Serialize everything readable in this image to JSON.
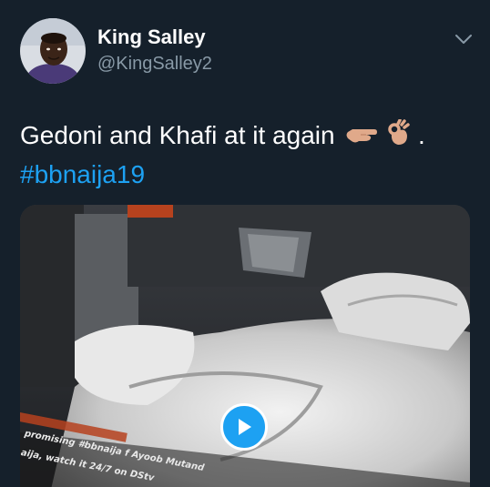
{
  "tweet": {
    "author": {
      "display_name": "King Salley",
      "handle": "@KingSalley2",
      "avatar_icon": "avatar-photo"
    },
    "menu_icon": "chevron-down-icon",
    "text": "Gedoni and Khafi at it again",
    "text_suffix": ".",
    "emojis": [
      "backhand-index-pointing-left",
      "ok-hand"
    ],
    "hashtag": "#bbnaija19",
    "media": {
      "type": "video",
      "play_icon": "play-icon",
      "ticker_line_1": "promising #bbnaija  f Ayoob Mutand",
      "ticker_line_2": "aija, watch it 24/7 on DStv"
    },
    "colors": {
      "background": "#15202b",
      "text": "#ffffff",
      "secondary_text": "#8899a6",
      "link": "#1da1f2",
      "play_button": "#1da1f2"
    }
  }
}
